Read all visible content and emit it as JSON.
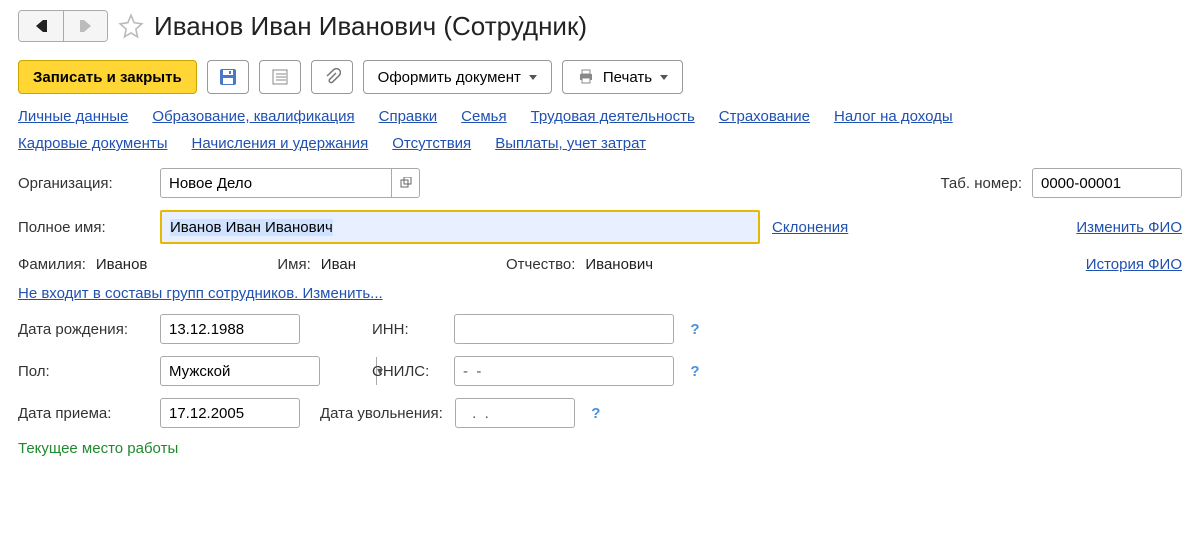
{
  "header": {
    "title": "Иванов Иван Иванович (Сотрудник)"
  },
  "toolbar": {
    "save_close": "Записать и закрыть",
    "issue_doc": "Оформить документ",
    "print": "Печать"
  },
  "tabs": {
    "row1": [
      "Личные данные",
      "Образование, квалификация",
      "Справки",
      "Семья",
      "Трудовая деятельность",
      "Страхование",
      "Налог на доходы"
    ],
    "row2": [
      "Кадровые документы",
      "Начисления и удержания",
      "Отсутствия",
      "Выплаты, учет затрат"
    ]
  },
  "form": {
    "org_label": "Организация:",
    "org_value": "Новое Дело",
    "tabno_label": "Таб. номер:",
    "tabno_value": "0000-00001",
    "fullname_label": "Полное имя:",
    "fullname_value": "Иванов Иван Иванович",
    "declensions_link": "Склонения",
    "change_fio_link": "Изменить ФИО",
    "surname_label": "Фамилия:",
    "surname_value": "Иванов",
    "name_label": "Имя:",
    "name_value": "Иван",
    "patronymic_label": "Отчество:",
    "patronymic_value": "Иванович",
    "history_fio_link": "История ФИО",
    "groups_link": "Не входит в составы групп сотрудников. Изменить...",
    "dob_label": "Дата рождения:",
    "dob_value": "13.12.1988",
    "inn_label": "ИНН:",
    "inn_value": "",
    "sex_label": "Пол:",
    "sex_value": "Мужской",
    "snils_label": "СНИЛС:",
    "snils_value": "-  -",
    "hire_label": "Дата приема:",
    "hire_value": "17.12.2005",
    "fire_label": "Дата увольнения:",
    "fire_value": "  .  .",
    "current_workplace": "Текущее место работы"
  }
}
